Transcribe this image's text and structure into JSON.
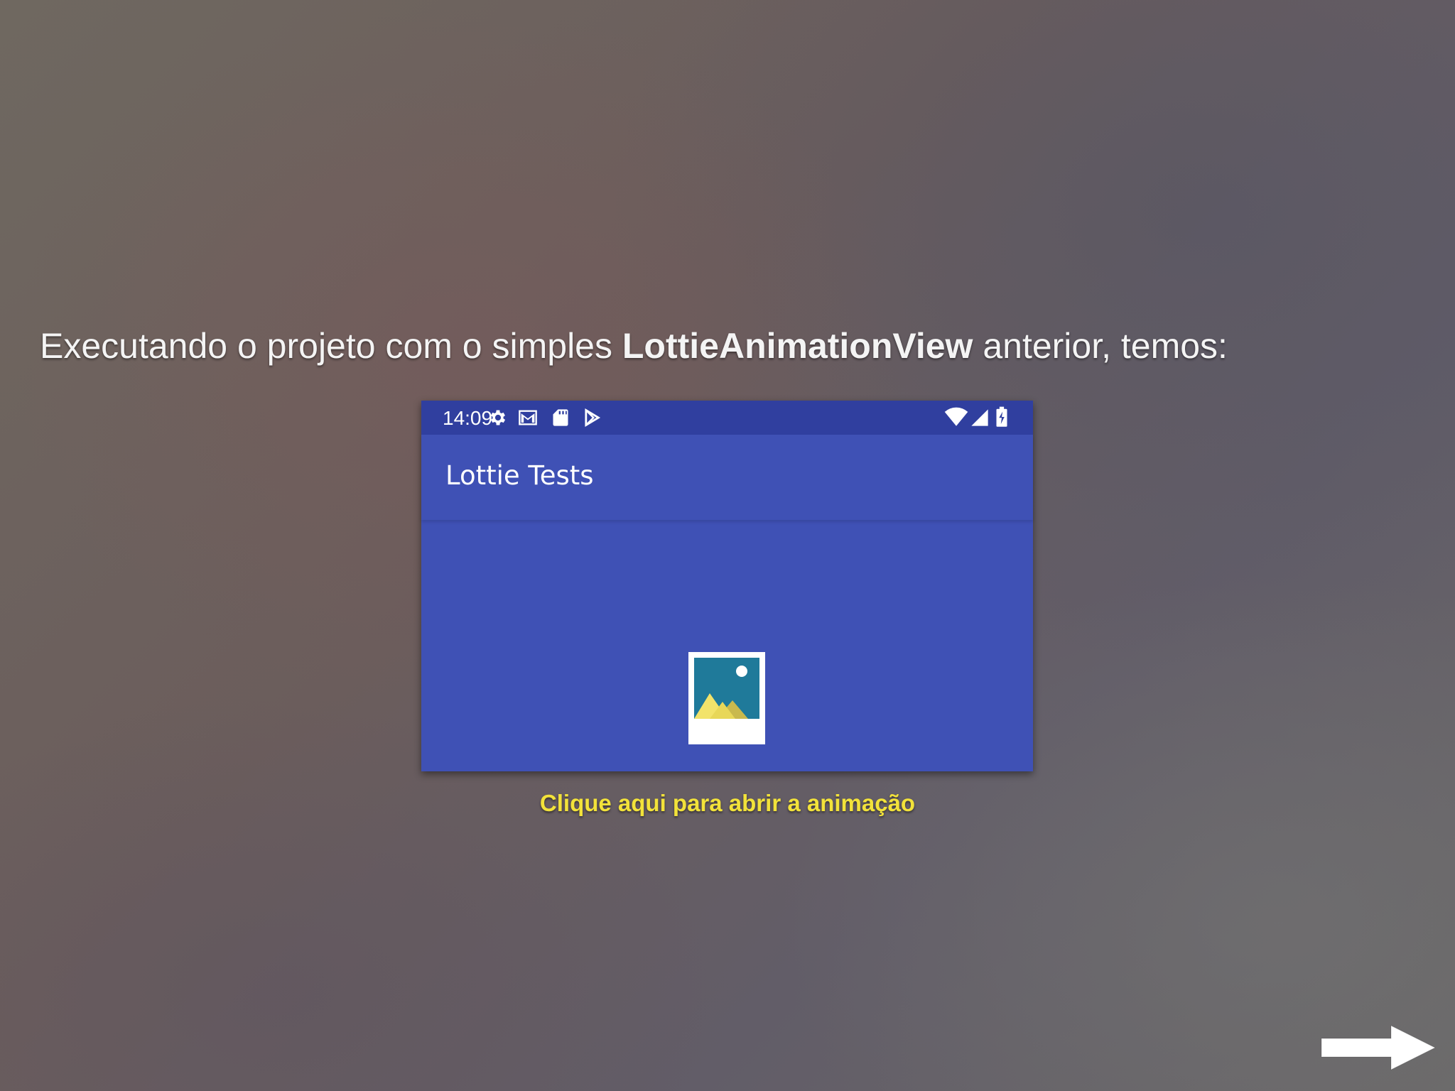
{
  "slide": {
    "text_before": "Executando o projeto com o simples ",
    "text_bold": "LottieAnimationView",
    "text_after": " anterior, temos:",
    "caption_link": "Clique aqui para abrir a animação"
  },
  "phone": {
    "status_time": "14:09",
    "status_icons_left": [
      "settings-icon",
      "gmail-icon",
      "sd-card-icon",
      "play-store-icon"
    ],
    "status_icons_right": [
      "wifi-icon",
      "cellular-signal-icon",
      "battery-charging-icon"
    ],
    "app_title": "Lottie Tests",
    "content_icon": "image-placeholder-icon"
  },
  "navigation": {
    "next_icon": "right-arrow-icon"
  },
  "colors": {
    "status_bar": "#303f9f",
    "app_bar": "#3f51b5",
    "caption": "#f2e23a"
  }
}
